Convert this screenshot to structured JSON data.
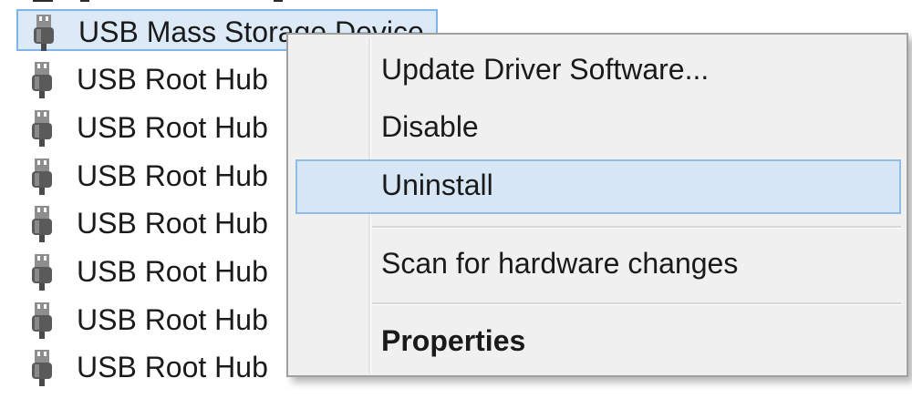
{
  "device_list": {
    "items": [
      {
        "label": "USB Mass Storage Device",
        "icon": "usb-plug-icon",
        "selected": true
      },
      {
        "label": "USB Root Hub",
        "icon": "usb-plug-icon",
        "selected": false
      },
      {
        "label": "USB Root Hub",
        "icon": "usb-plug-icon",
        "selected": false
      },
      {
        "label": "USB Root Hub",
        "icon": "usb-plug-icon",
        "selected": false
      },
      {
        "label": "USB Root Hub",
        "icon": "usb-plug-icon",
        "selected": false
      },
      {
        "label": "USB Root Hub",
        "icon": "usb-plug-icon",
        "selected": false
      },
      {
        "label": "USB Root Hub",
        "icon": "usb-plug-icon",
        "selected": false
      },
      {
        "label": "USB Root Hub",
        "icon": "usb-plug-icon",
        "selected": false
      }
    ]
  },
  "context_menu": {
    "items": [
      {
        "label": "Update Driver Software..."
      },
      {
        "label": "Disable"
      },
      {
        "label": "Uninstall",
        "highlighted": true
      },
      {
        "label": "Scan for hardware changes"
      },
      {
        "label": "Properties",
        "bold": true
      }
    ]
  },
  "colors": {
    "selection_fill": "#dceaf8",
    "selection_border": "#7eb4ea",
    "menu_background": "#f0f0f0",
    "menu_highlight": "#d6e6f5"
  }
}
